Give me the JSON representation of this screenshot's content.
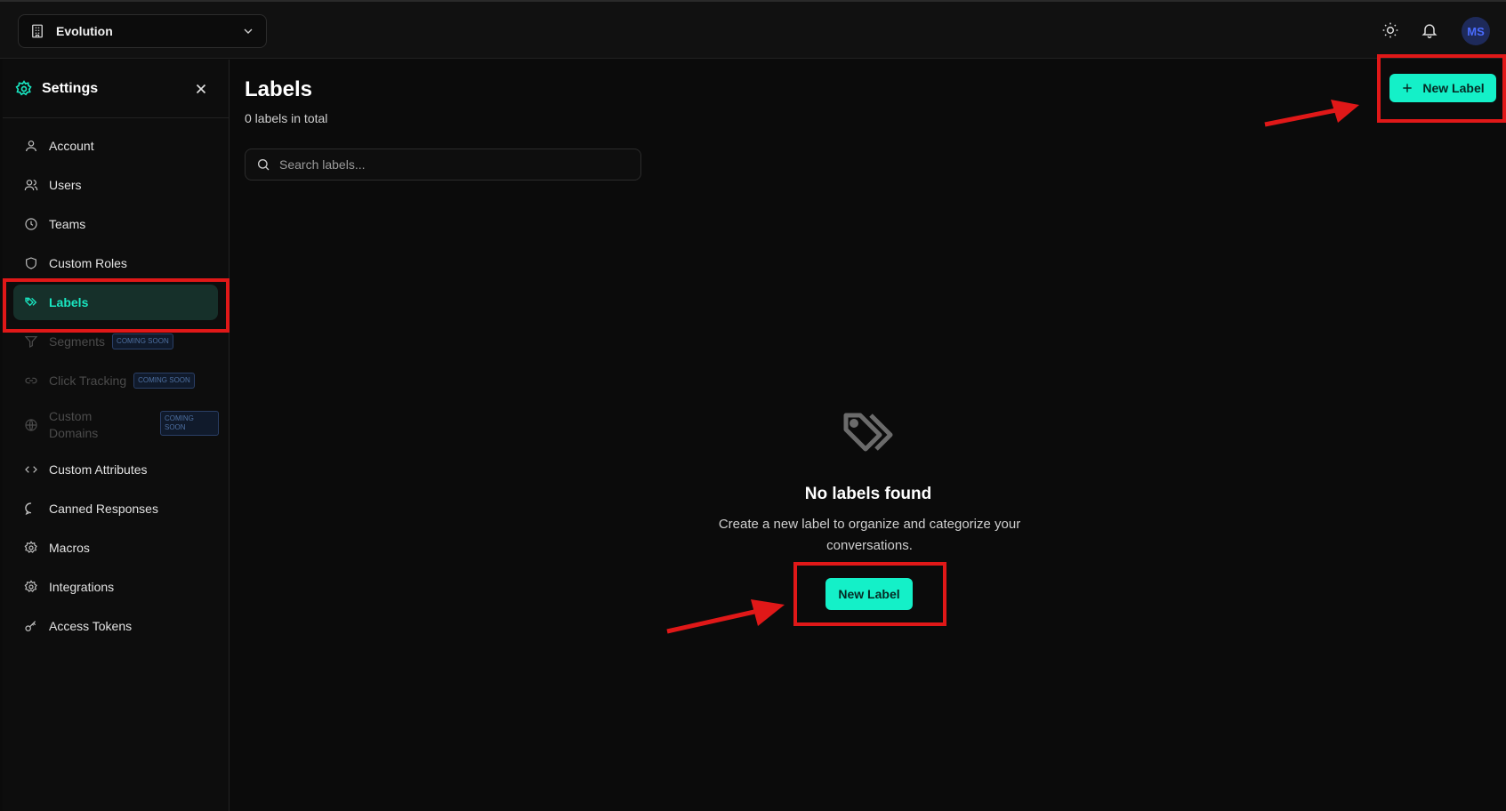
{
  "topbar": {
    "workspace_name": "Evolution",
    "avatar_initials": "MS",
    "icons": [
      "building-icon",
      "chevron-down-icon",
      "sun-icon",
      "bell-icon"
    ]
  },
  "sidebar": {
    "title": "Settings",
    "items": [
      {
        "label": "Account",
        "icon": "user-icon"
      },
      {
        "label": "Users",
        "icon": "users-icon"
      },
      {
        "label": "Teams",
        "icon": "clock-icon"
      },
      {
        "label": "Custom Roles",
        "icon": "shield-icon"
      },
      {
        "label": "Labels",
        "icon": "tags-icon",
        "active": true
      },
      {
        "label": "Segments",
        "icon": "filter-icon",
        "badge": "COMING SOON",
        "disabled": true
      },
      {
        "label": "Click Tracking",
        "icon": "link-icon",
        "badge": "COMING SOON",
        "disabled": true
      },
      {
        "label": "Custom Domains",
        "icon": "globe-icon",
        "badge": "COMING SOON",
        "disabled": true
      },
      {
        "label": "Custom Attributes",
        "icon": "code-icon"
      },
      {
        "label": "Canned Responses",
        "icon": "message-icon"
      },
      {
        "label": "Macros",
        "icon": "gear-icon"
      },
      {
        "label": "Integrations",
        "icon": "gear-icon"
      },
      {
        "label": "Access Tokens",
        "icon": "key-icon"
      }
    ]
  },
  "main": {
    "title": "Labels",
    "subtitle": "0 labels in total",
    "new_label_button": "New Label",
    "search": {
      "placeholder": "Search labels...",
      "value": ""
    },
    "empty_state": {
      "title": "No labels found",
      "description": "Create a new label to organize and categorize your conversations.",
      "button": "New Label"
    }
  },
  "colors": {
    "accent": "#14f0c8",
    "active_nav_bg": "#16302a",
    "highlight": "#e01818",
    "background": "#0b0b0b"
  }
}
